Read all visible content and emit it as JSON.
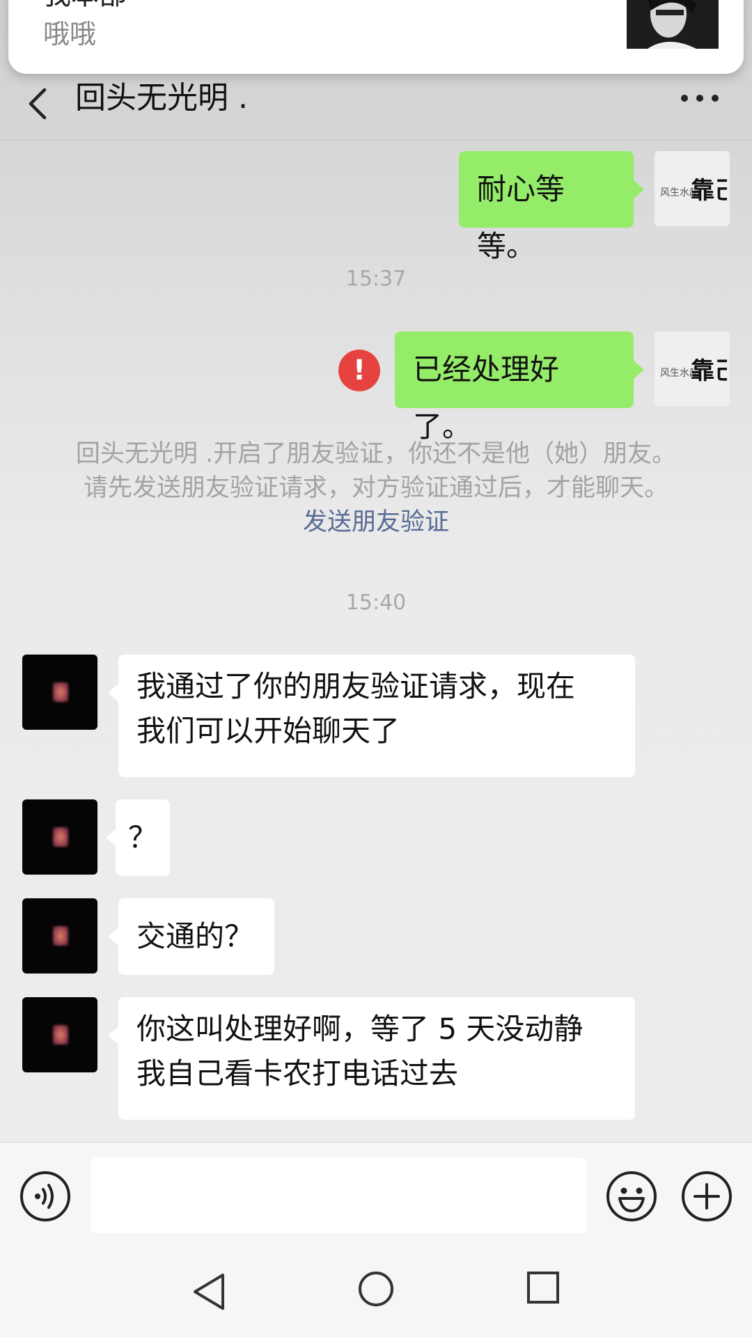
{
  "notification": {
    "sender": "我本部",
    "message": "哦哦"
  },
  "header": {
    "title": "回头无光明 ."
  },
  "messages": {
    "m1": "耐心等等。",
    "ts1": "15:37",
    "m2": "已经处理好了。",
    "m2_error": "!",
    "notice_line1": "回头无光明 .开启了朋友验证，你还不是他（她）朋友。",
    "notice_line2": "请先发送朋友验证请求，对方验证通过后，才能聊天。",
    "notice_link": "发送朋友验证",
    "ts2": "15:40",
    "m3_line1": "我通过了你的朋友验证请求，现在",
    "m3_line2": "我们可以开始聊天了",
    "m4": "？",
    "m5": "交通的？",
    "m6_line1": "你这叫处理好啊，等了 5 天没动静",
    "m6_line2": "我自己看卡农打电话过去"
  },
  "input": {
    "value": "",
    "placeholder": ""
  },
  "colors": {
    "my_bubble": "#95ec69",
    "their_bubble": "#ffffff",
    "error": "#e64340",
    "link": "#576b95"
  },
  "icons": [
    "back-arrow-icon",
    "more-icon",
    "error-icon",
    "voice-icon",
    "emoji-icon",
    "plus-icon",
    "nav-back-icon",
    "nav-home-icon",
    "nav-recent-icon"
  ]
}
